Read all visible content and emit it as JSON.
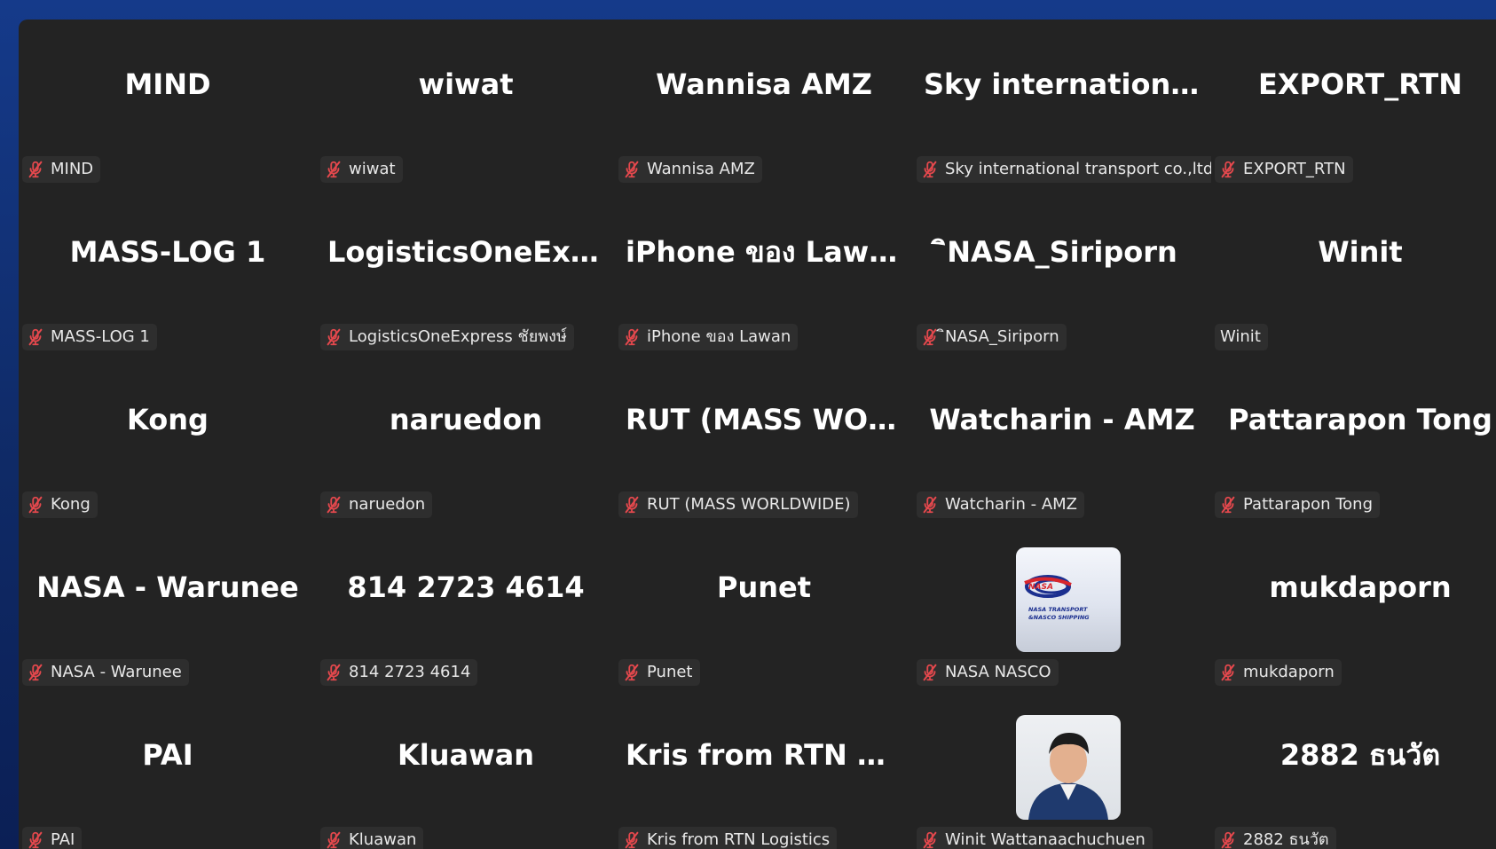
{
  "participants": [
    {
      "display": "MIND",
      "label": "MIND",
      "muted": true
    },
    {
      "display": "wiwat",
      "label": "wiwat",
      "muted": true
    },
    {
      "display": "Wannisa AMZ",
      "label": "Wannisa AMZ",
      "muted": true
    },
    {
      "display": "Sky international transport co.,ltd",
      "label": "Sky international transport co.,ltd",
      "muted": true
    },
    {
      "display": "EXPORT_RTN",
      "label": "EXPORT_RTN",
      "muted": true
    },
    {
      "display": "MASS-LOG 1",
      "label": "MASS-LOG 1",
      "muted": true
    },
    {
      "display": "LogisticsOneExpress ชัยพงษ์",
      "label": "LogisticsOneExpress ชัยพงษ์",
      "muted": true
    },
    {
      "display": "iPhone ของ Lawan",
      "label": "iPhone ของ Lawan",
      "muted": true
    },
    {
      "display": "ิNASA_Siriporn",
      "label": "ิNASA_Siriporn",
      "muted": true
    },
    {
      "display": "Winit",
      "label": "Winit",
      "muted": false
    },
    {
      "display": "Kong",
      "label": "Kong",
      "muted": true
    },
    {
      "display": "naruedon",
      "label": "naruedon",
      "muted": true
    },
    {
      "display": "RUT (MASS WORLDWIDE)",
      "label": "RUT (MASS WORLDWIDE)",
      "muted": true
    },
    {
      "display": "Watcharin - AMZ",
      "label": "Watcharin - AMZ",
      "muted": true
    },
    {
      "display": "Pattarapon Tong",
      "label": "Pattarapon Tong",
      "muted": true
    },
    {
      "display": "NASA - Warunee",
      "label": "NASA - Warunee",
      "muted": true
    },
    {
      "display": "814 2723 4614",
      "label": "814 2723 4614",
      "muted": true
    },
    {
      "display": "Punet",
      "label": "Punet",
      "muted": true
    },
    {
      "display": "",
      "label": "NASA NASCO",
      "muted": true,
      "avatar": "nasa-logo"
    },
    {
      "display": "mukdaporn",
      "label": "mukdaporn",
      "muted": true
    },
    {
      "display": "PAI",
      "label": "PAI",
      "muted": true
    },
    {
      "display": "Kluawan",
      "label": "Kluawan",
      "muted": true
    },
    {
      "display": "Kris from RTN Logistics",
      "label": "Kris from RTN Logistics",
      "muted": true
    },
    {
      "display": "",
      "label": "Winit Wattanaachuchuen",
      "muted": true,
      "avatar": "person-photo"
    },
    {
      "display": "2882 ธนวัต",
      "label": "2882 ธนวัต",
      "muted": true
    }
  ],
  "logo_text": {
    "line1": "NASA TRANSPORT",
    "line2": "&NASCO SHIPPING",
    "brand": "NASA NASCO"
  },
  "colors": {
    "window_bg": "#232323",
    "label_bg": "#2e2e2e",
    "mute_icon": "#e5484d",
    "desktop_bg": "#13347c"
  }
}
